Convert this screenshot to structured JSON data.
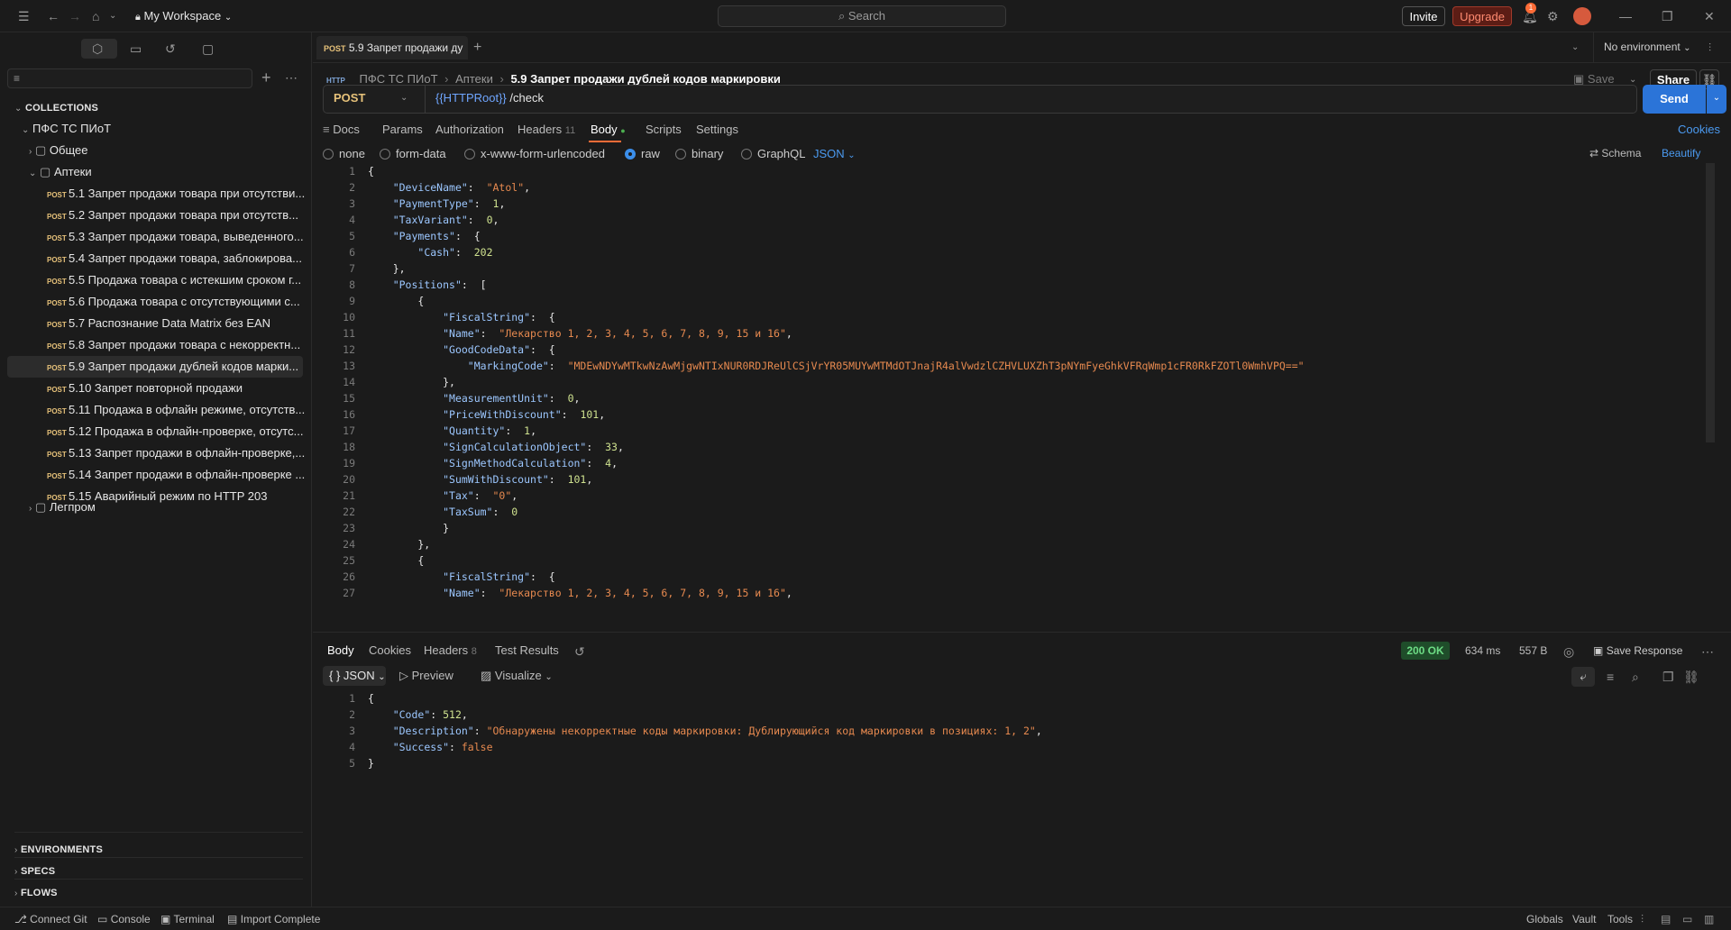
{
  "topbar": {
    "workspace": "My Workspace",
    "search_placeholder": "Search",
    "invite": "Invite",
    "upgrade": "Upgrade",
    "notif_count": "1"
  },
  "sidebar": {
    "collections_title": "COLLECTIONS",
    "root": "ПФС ТС ПИоТ",
    "folders": [
      "Общее",
      "Аптеки",
      "Легпром"
    ],
    "method": "POST",
    "requests": [
      "5.1 Запрет продажи товара при отсутстви...",
      "5.2 Запрет продажи товара при отсутств...",
      "5.3 Запрет продажи товара, выведенного...",
      "5.4 Запрет продажи товара, заблокирова...",
      "5.5 Продажа товара с истекшим сроком г...",
      "5.6 Продажа товара с отсутствующими с...",
      "5.7 Распознание Data Matrix без EAN",
      "5.8 Запрет продажи товара с некорректн...",
      "5.9 Запрет продажи дублей кодов марки...",
      "5.10 Запрет повторной продажи",
      "5.11 Продажа в офлайн режиме, отсутств...",
      "5.12 Продажа в офлайн-проверке, отсутс...",
      "5.13 Запрет продажи в офлайн-проверке,...",
      "5.14 Запрет продажи в офлайн-проверке ...",
      "5.15 Аварийный режим по HTTP 203"
    ],
    "bottom_sections": [
      "ENVIRONMENTS",
      "SPECS",
      "FLOWS"
    ]
  },
  "tab": {
    "method": "POST",
    "title": "5.9 Запрет продажи ду"
  },
  "environment": "No environment",
  "breadcrumb": {
    "http": "HTTP",
    "parts": [
      "ПФС ТС ПИоТ",
      "Аптеки"
    ],
    "current": "5.9 Запрет продажи дублей кодов маркировки"
  },
  "actions": {
    "save": "Save",
    "share": "Share"
  },
  "request": {
    "method": "POST",
    "url_var": "{{HTTPRoot}}",
    "url_path": " /check",
    "send": "Send"
  },
  "req_tabs": {
    "docs": "Docs",
    "params": "Params",
    "authorization": "Authorization",
    "headers": "Headers",
    "headers_count": "11",
    "body": "Body",
    "scripts": "Scripts",
    "settings": "Settings",
    "cookies": "Cookies"
  },
  "body_types": {
    "none": "none",
    "form_data": "form-data",
    "urlencoded": "x-www-form-urlencoded",
    "raw": "raw",
    "binary": "binary",
    "graphql": "GraphQL",
    "json": "JSON",
    "schema": "Schema",
    "beautify": "Beautify"
  },
  "request_body": [
    [
      {
        "t": "p",
        "v": "{"
      }
    ],
    [
      {
        "t": "p",
        "v": "    "
      },
      {
        "t": "k",
        "v": "\"DeviceName\""
      },
      {
        "t": "p",
        "v": ":  "
      },
      {
        "t": "s",
        "v": "\"Atol\""
      },
      {
        "t": "p",
        "v": ","
      }
    ],
    [
      {
        "t": "p",
        "v": "    "
      },
      {
        "t": "k",
        "v": "\"PaymentType\""
      },
      {
        "t": "p",
        "v": ":  "
      },
      {
        "t": "n",
        "v": "1"
      },
      {
        "t": "p",
        "v": ","
      }
    ],
    [
      {
        "t": "p",
        "v": "    "
      },
      {
        "t": "k",
        "v": "\"TaxVariant\""
      },
      {
        "t": "p",
        "v": ":  "
      },
      {
        "t": "n",
        "v": "0"
      },
      {
        "t": "p",
        "v": ","
      }
    ],
    [
      {
        "t": "p",
        "v": "    "
      },
      {
        "t": "k",
        "v": "\"Payments\""
      },
      {
        "t": "p",
        "v": ":  {"
      }
    ],
    [
      {
        "t": "p",
        "v": "        "
      },
      {
        "t": "k",
        "v": "\"Cash\""
      },
      {
        "t": "p",
        "v": ":  "
      },
      {
        "t": "n",
        "v": "202"
      }
    ],
    [
      {
        "t": "p",
        "v": "    },"
      }
    ],
    [
      {
        "t": "p",
        "v": "    "
      },
      {
        "t": "k",
        "v": "\"Positions\""
      },
      {
        "t": "p",
        "v": ":  ["
      }
    ],
    [
      {
        "t": "p",
        "v": "        {"
      }
    ],
    [
      {
        "t": "p",
        "v": "            "
      },
      {
        "t": "k",
        "v": "\"FiscalString\""
      },
      {
        "t": "p",
        "v": ":  {"
      }
    ],
    [
      {
        "t": "p",
        "v": "            "
      },
      {
        "t": "k",
        "v": "\"Name\""
      },
      {
        "t": "p",
        "v": ":  "
      },
      {
        "t": "s",
        "v": "\"Лекарство 1, 2, 3, 4, 5, 6, 7, 8, 9, 15 и 16\""
      },
      {
        "t": "p",
        "v": ","
      }
    ],
    [
      {
        "t": "p",
        "v": "            "
      },
      {
        "t": "k",
        "v": "\"GoodCodeData\""
      },
      {
        "t": "p",
        "v": ":  {"
      }
    ],
    [
      {
        "t": "p",
        "v": "                "
      },
      {
        "t": "k",
        "v": "\"MarkingCode\""
      },
      {
        "t": "p",
        "v": ":  "
      },
      {
        "t": "s",
        "v": "\"MDEwNDYwMTkwNzAwMjgwNTIxNUR0RDJReUlCSjVrYR05MUYwMTMdOTJnajR4alVwdzlCZHVLUXZhT3pNYmFyeGhkVFRqWmp1cFR0RkFZOTl0WmhVPQ==\""
      }
    ],
    [
      {
        "t": "p",
        "v": "            },"
      }
    ],
    [
      {
        "t": "p",
        "v": "            "
      },
      {
        "t": "k",
        "v": "\"MeasurementUnit\""
      },
      {
        "t": "p",
        "v": ":  "
      },
      {
        "t": "n",
        "v": "0"
      },
      {
        "t": "p",
        "v": ","
      }
    ],
    [
      {
        "t": "p",
        "v": "            "
      },
      {
        "t": "k",
        "v": "\"PriceWithDiscount\""
      },
      {
        "t": "p",
        "v": ":  "
      },
      {
        "t": "n",
        "v": "101"
      },
      {
        "t": "p",
        "v": ","
      }
    ],
    [
      {
        "t": "p",
        "v": "            "
      },
      {
        "t": "k",
        "v": "\"Quantity\""
      },
      {
        "t": "p",
        "v": ":  "
      },
      {
        "t": "n",
        "v": "1"
      },
      {
        "t": "p",
        "v": ","
      }
    ],
    [
      {
        "t": "p",
        "v": "            "
      },
      {
        "t": "k",
        "v": "\"SignCalculationObject\""
      },
      {
        "t": "p",
        "v": ":  "
      },
      {
        "t": "n",
        "v": "33"
      },
      {
        "t": "p",
        "v": ","
      }
    ],
    [
      {
        "t": "p",
        "v": "            "
      },
      {
        "t": "k",
        "v": "\"SignMethodCalculation\""
      },
      {
        "t": "p",
        "v": ":  "
      },
      {
        "t": "n",
        "v": "4"
      },
      {
        "t": "p",
        "v": ","
      }
    ],
    [
      {
        "t": "p",
        "v": "            "
      },
      {
        "t": "k",
        "v": "\"SumWithDiscount\""
      },
      {
        "t": "p",
        "v": ":  "
      },
      {
        "t": "n",
        "v": "101"
      },
      {
        "t": "p",
        "v": ","
      }
    ],
    [
      {
        "t": "p",
        "v": "            "
      },
      {
        "t": "k",
        "v": "\"Tax\""
      },
      {
        "t": "p",
        "v": ":  "
      },
      {
        "t": "s",
        "v": "\"0\""
      },
      {
        "t": "p",
        "v": ","
      }
    ],
    [
      {
        "t": "p",
        "v": "            "
      },
      {
        "t": "k",
        "v": "\"TaxSum\""
      },
      {
        "t": "p",
        "v": ":  "
      },
      {
        "t": "n",
        "v": "0"
      }
    ],
    [
      {
        "t": "p",
        "v": "            }"
      }
    ],
    [
      {
        "t": "p",
        "v": "        },"
      }
    ],
    [
      {
        "t": "p",
        "v": "        {"
      }
    ],
    [
      {
        "t": "p",
        "v": "            "
      },
      {
        "t": "k",
        "v": "\"FiscalString\""
      },
      {
        "t": "p",
        "v": ":  {"
      }
    ],
    [
      {
        "t": "p",
        "v": "            "
      },
      {
        "t": "k",
        "v": "\"Name\""
      },
      {
        "t": "p",
        "v": ":  "
      },
      {
        "t": "s",
        "v": "\"Лекарство 1, 2, 3, 4, 5, 6, 7, 8, 9, 15 и 16\""
      },
      {
        "t": "p",
        "v": ","
      }
    ]
  ],
  "response": {
    "tabs": {
      "body": "Body",
      "cookies": "Cookies",
      "headers": "Headers",
      "headers_count": "8",
      "tests": "Test Results"
    },
    "status": "200 OK",
    "time": "634 ms",
    "size": "557 B",
    "save": "Save Response",
    "format": "JSON",
    "preview": "Preview",
    "visualize": "Visualize",
    "body": [
      [
        {
          "t": "p",
          "v": "{"
        }
      ],
      [
        {
          "t": "p",
          "v": "    "
        },
        {
          "t": "k",
          "v": "\"Code\""
        },
        {
          "t": "p",
          "v": ": "
        },
        {
          "t": "n",
          "v": "512"
        },
        {
          "t": "p",
          "v": ","
        }
      ],
      [
        {
          "t": "p",
          "v": "    "
        },
        {
          "t": "k",
          "v": "\"Description\""
        },
        {
          "t": "p",
          "v": ": "
        },
        {
          "t": "s",
          "v": "\"Обнаружены некорректные коды маркировки: Дублирующийся код маркировки в позициях: 1, 2\""
        },
        {
          "t": "p",
          "v": ","
        }
      ],
      [
        {
          "t": "p",
          "v": "    "
        },
        {
          "t": "k",
          "v": "\"Success\""
        },
        {
          "t": "p",
          "v": ": "
        },
        {
          "t": "f",
          "v": "false"
        }
      ],
      [
        {
          "t": "p",
          "v": "}"
        }
      ]
    ]
  },
  "statusbar": {
    "connect_git": "Connect Git",
    "console": "Console",
    "terminal": "Terminal",
    "import": "Import Complete",
    "globals": "Globals",
    "vault": "Vault",
    "tools": "Tools"
  }
}
